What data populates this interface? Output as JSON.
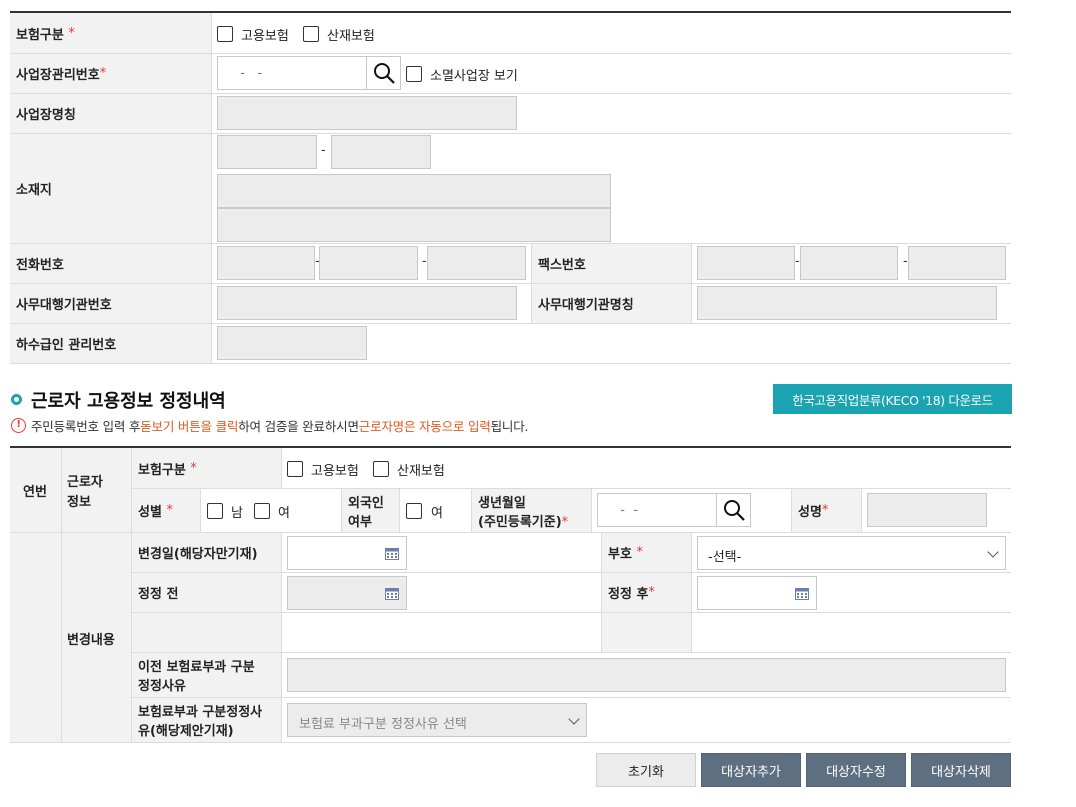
{
  "section1": {
    "ins_type_label": "보험구분",
    "ins_opt1": "고용보험",
    "ins_opt2": "산재보험",
    "biz_no_label": "사업장관리번호",
    "biz_no_placeholder": "  -   -    ",
    "closed_biz_label": "소멸사업장 보기",
    "biz_name_label": "사업장명칭",
    "address_label": "소재지",
    "address_dash": "-",
    "phone_label": "전화번호",
    "fax_label": "팩스번호",
    "agency_no_label": "사무대행기관번호",
    "agency_name_label": "사무대행기관명칭",
    "subcontract_label": "하수급인 관리번호",
    "dash": "-"
  },
  "section2": {
    "title": "근로자 고용정보 정정내역",
    "download_button": "한국고용직업분류(KECO '18) 다운로드",
    "notice_part1": "주민등록번호 입력 후 ",
    "notice_part2": "돋보기 버튼을 클릭",
    "notice_part3": "하여 검증을 완료하시면 ",
    "notice_part4": "근로자명은 자동으로 입력",
    "notice_part5": "됩니다.",
    "col_seq": "연번",
    "col_worker_info_1": "근로자",
    "col_worker_info_2": "정보",
    "ins_type_label": "보험구분",
    "ins_opt1": "고용보험",
    "ins_opt2": "산재보험",
    "gender_label": "성별",
    "gender_male": "남",
    "gender_female": "여",
    "foreigner_label_1": "외국인",
    "foreigner_label_2": "여부",
    "foreigner_yes": "여",
    "birth_label_1": "생년월일",
    "birth_label_2": "(주민등록기준)",
    "birth_placeholder": "  -  -  ",
    "name_label": "성명",
    "change_content_label": "변경내용",
    "change_date_label": "변경일(해당자만기재)",
    "code_label": "부호",
    "code_select": "-선택-",
    "before_label": "정정 전",
    "after_label": "정정 후",
    "prev_reason_label_1": "이전 보험료부과 구분",
    "prev_reason_label_2": "정정사유",
    "reason_label_1": "보험료부과 구분정정사",
    "reason_label_2": "유(해당제안기재)",
    "reason_select": "보험료 부과구분 정정사유 선택",
    "required_mark": "*"
  },
  "buttons": {
    "reset": "초기화",
    "add": "대상자추가",
    "edit": "대상자수정",
    "delete": "대상자삭제"
  },
  "colors": {
    "teal": "#1aa3b0",
    "dark_button": "#5f6f82",
    "required": "#e53935",
    "header_bg": "#f2f2f2"
  }
}
